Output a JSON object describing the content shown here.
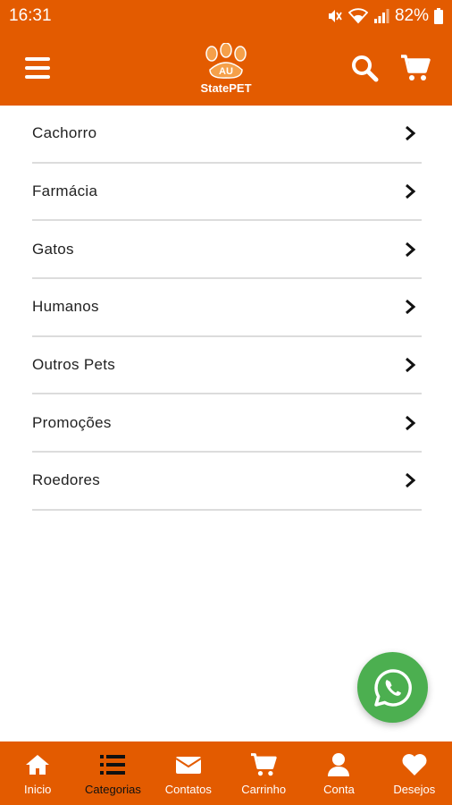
{
  "status_bar": {
    "time": "16:31",
    "battery": "82%",
    "icons": [
      "mute-icon",
      "wifi-icon",
      "signal-icon",
      "battery-icon"
    ]
  },
  "app_bar": {
    "logo_badge": "AU",
    "logo_text": "StatePET",
    "icons": [
      "menu-icon",
      "search-icon",
      "cart-icon"
    ]
  },
  "categories": [
    {
      "label": "Cachorro"
    },
    {
      "label": "Farmácia"
    },
    {
      "label": "Gatos"
    },
    {
      "label": "Humanos"
    },
    {
      "label": "Outros Pets"
    },
    {
      "label": "Promoções"
    },
    {
      "label": "Roedores"
    }
  ],
  "fab": {
    "icon": "whatsapp-icon"
  },
  "bottom_nav": [
    {
      "label": "Inicio",
      "icon": "home-icon"
    },
    {
      "label": "Categorias",
      "icon": "list-icon",
      "active": true
    },
    {
      "label": "Contatos",
      "icon": "envelope-icon"
    },
    {
      "label": "Carrinho",
      "icon": "cart-icon"
    },
    {
      "label": "Conta",
      "icon": "user-icon"
    },
    {
      "label": "Desejos",
      "icon": "heart-icon"
    }
  ],
  "colors": {
    "primary": "#E35B00",
    "whatsapp": "#4CAF50",
    "text": "#222222",
    "divider": "#dcdcdc"
  }
}
